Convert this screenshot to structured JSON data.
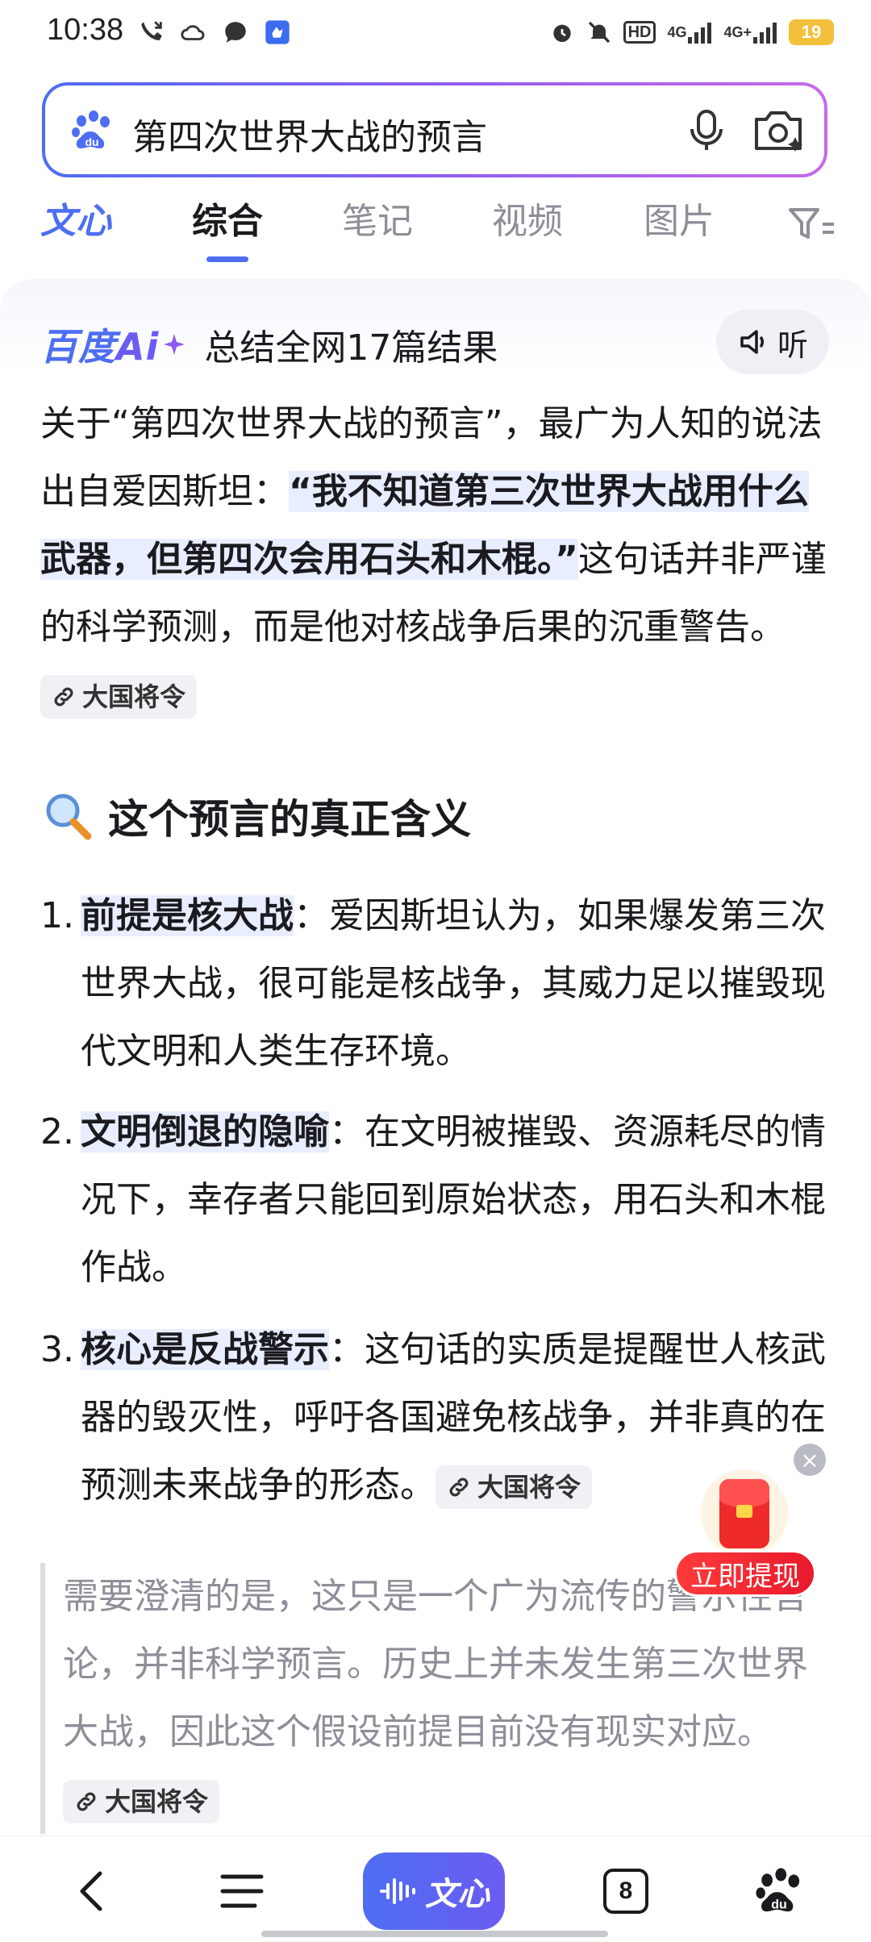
{
  "status_bar": {
    "time": "10:38",
    "left_icons": [
      "missed-call-icon",
      "cloud-icon",
      "chat-bubble-icon",
      "app-notification-icon"
    ],
    "right_icons": [
      "alarm-icon",
      "mute-icon",
      "hd-icon",
      "signal-4g-icon",
      "signal-4g-plus-icon"
    ],
    "hd_label": "HD",
    "net1": "4G",
    "net2": "4G+",
    "battery": "19"
  },
  "search": {
    "query": "第四次世界大战的预言"
  },
  "tabs": {
    "wenxin": "文心",
    "items": [
      "综合",
      "笔记",
      "视频",
      "图片"
    ]
  },
  "ai": {
    "logo_main": "百度",
    "logo_ai": "Ai",
    "summary": "总结全网17篇结果",
    "listen": "听"
  },
  "intro": {
    "t1": "关于“第四次世界大战的预言”，最广为人知的说法出自爱因斯坦：",
    "quote": "“我不知道第三次世界大战用什么武器，但第四次会用石头和木棍。”",
    "t2": "这句话并非严谨的科学预测，而是他对核战争后果的沉重警告。",
    "cite": "大国将令"
  },
  "section": {
    "title": "这个预言的真正含义"
  },
  "list": [
    {
      "num": "1.",
      "key": "前提是核大战",
      "text": "：爱因斯坦认为，如果爆发第三次世界大战，很可能是核战争，其威力足以摧毁现代文明和人类生存环境。"
    },
    {
      "num": "2.",
      "key": "文明倒退的隐喻",
      "text": "：在文明被摧毁、资源耗尽的情况下，幸存者只能回到原始状态，用石头和木棍作战。"
    },
    {
      "num": "3.",
      "key": "核心是反战警示",
      "text": "：这句话的实质是提醒世人核武器的毁灭性，呼吁各国避免核战争，并非真的在预测未来战争的形态。",
      "cite": "大国将令"
    }
  ],
  "note": {
    "text": "需要澄清的是，这只是一个广为流传的警示性言论，并非科学预言。历史上并未发生第三次世界大战，因此这个假设前提目前没有现实对应。",
    "cite": "大国将令"
  },
  "float": {
    "close": "×",
    "button": "立即提现"
  },
  "bottom_nav": {
    "wenxin": "文心",
    "tab_count": "8"
  },
  "colors": {
    "accent": "#4e6ef2",
    "highlight": "#e8edff",
    "red": "#e8192c"
  }
}
